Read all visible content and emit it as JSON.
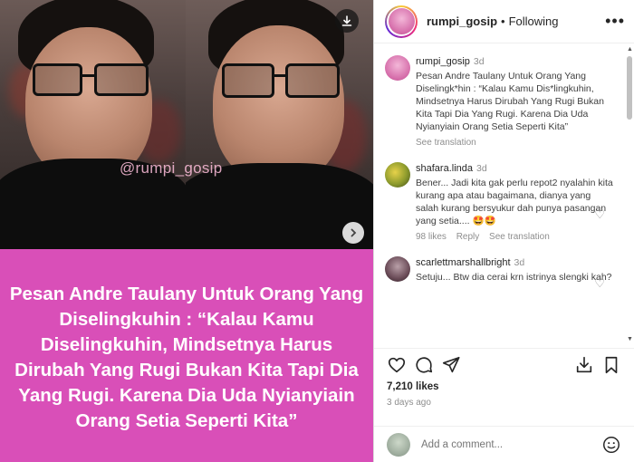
{
  "media": {
    "watermark": "@rumpi_gosip",
    "caption_image_text": "Pesan Andre Taulany Untuk Orang Yang Diselingkuhin : “Kalau Kamu Diselingkuhin, Mindsetnya Harus Dirubah Yang Rugi Bukan Kita Tapi Dia Yang Rugi. Karena Dia Uda Nyianyiain Orang Setia Seperti Kita”",
    "pink_color": "#d94fb8"
  },
  "header": {
    "username": "rumpi_gosip",
    "separator": "•",
    "follow_status": "Following",
    "more_label": "•••"
  },
  "comments": [
    {
      "username": "rumpi_gosip",
      "time": "3d",
      "text": "Pesan Andre Taulany Untuk Orang Yang Diselingk*hin : “Kalau Kamu Dis*lingkuhin, Mindsetnya Harus Dirubah Yang Rugi Bukan Kita Tapi Dia Yang Rugi. Karena Dia Uda Nyianyiain Orang Setia Seperti Kita”",
      "see_translation": "See translation"
    },
    {
      "username": "shafara.linda",
      "time": "3d",
      "text": "Bener... Jadi kita gak perlu repot2 nyalahin kita kurang apa atau bagaimana, dianya yang salah kurang bersyukur dah punya pasangan yang setia.... 🤩🤩",
      "likes": "98 likes",
      "reply": "Reply",
      "see_translation": "See translation"
    },
    {
      "username": "scarlettmarshallbright",
      "time": "3d",
      "text": "Setuju... Btw dia cerai krn istrinya slengki kah?"
    }
  ],
  "post": {
    "likes": "7,210 likes",
    "ago": "3 days ago"
  },
  "add_comment": {
    "placeholder": "Add a comment..."
  },
  "icons": {
    "download": "download-icon",
    "next": "chevron-right-icon",
    "heart": "heart-icon",
    "comment": "comment-icon",
    "share": "paper-plane-icon",
    "save_alt": "download-tray-icon",
    "bookmark": "bookmark-icon",
    "emoji": "smiley-icon"
  }
}
